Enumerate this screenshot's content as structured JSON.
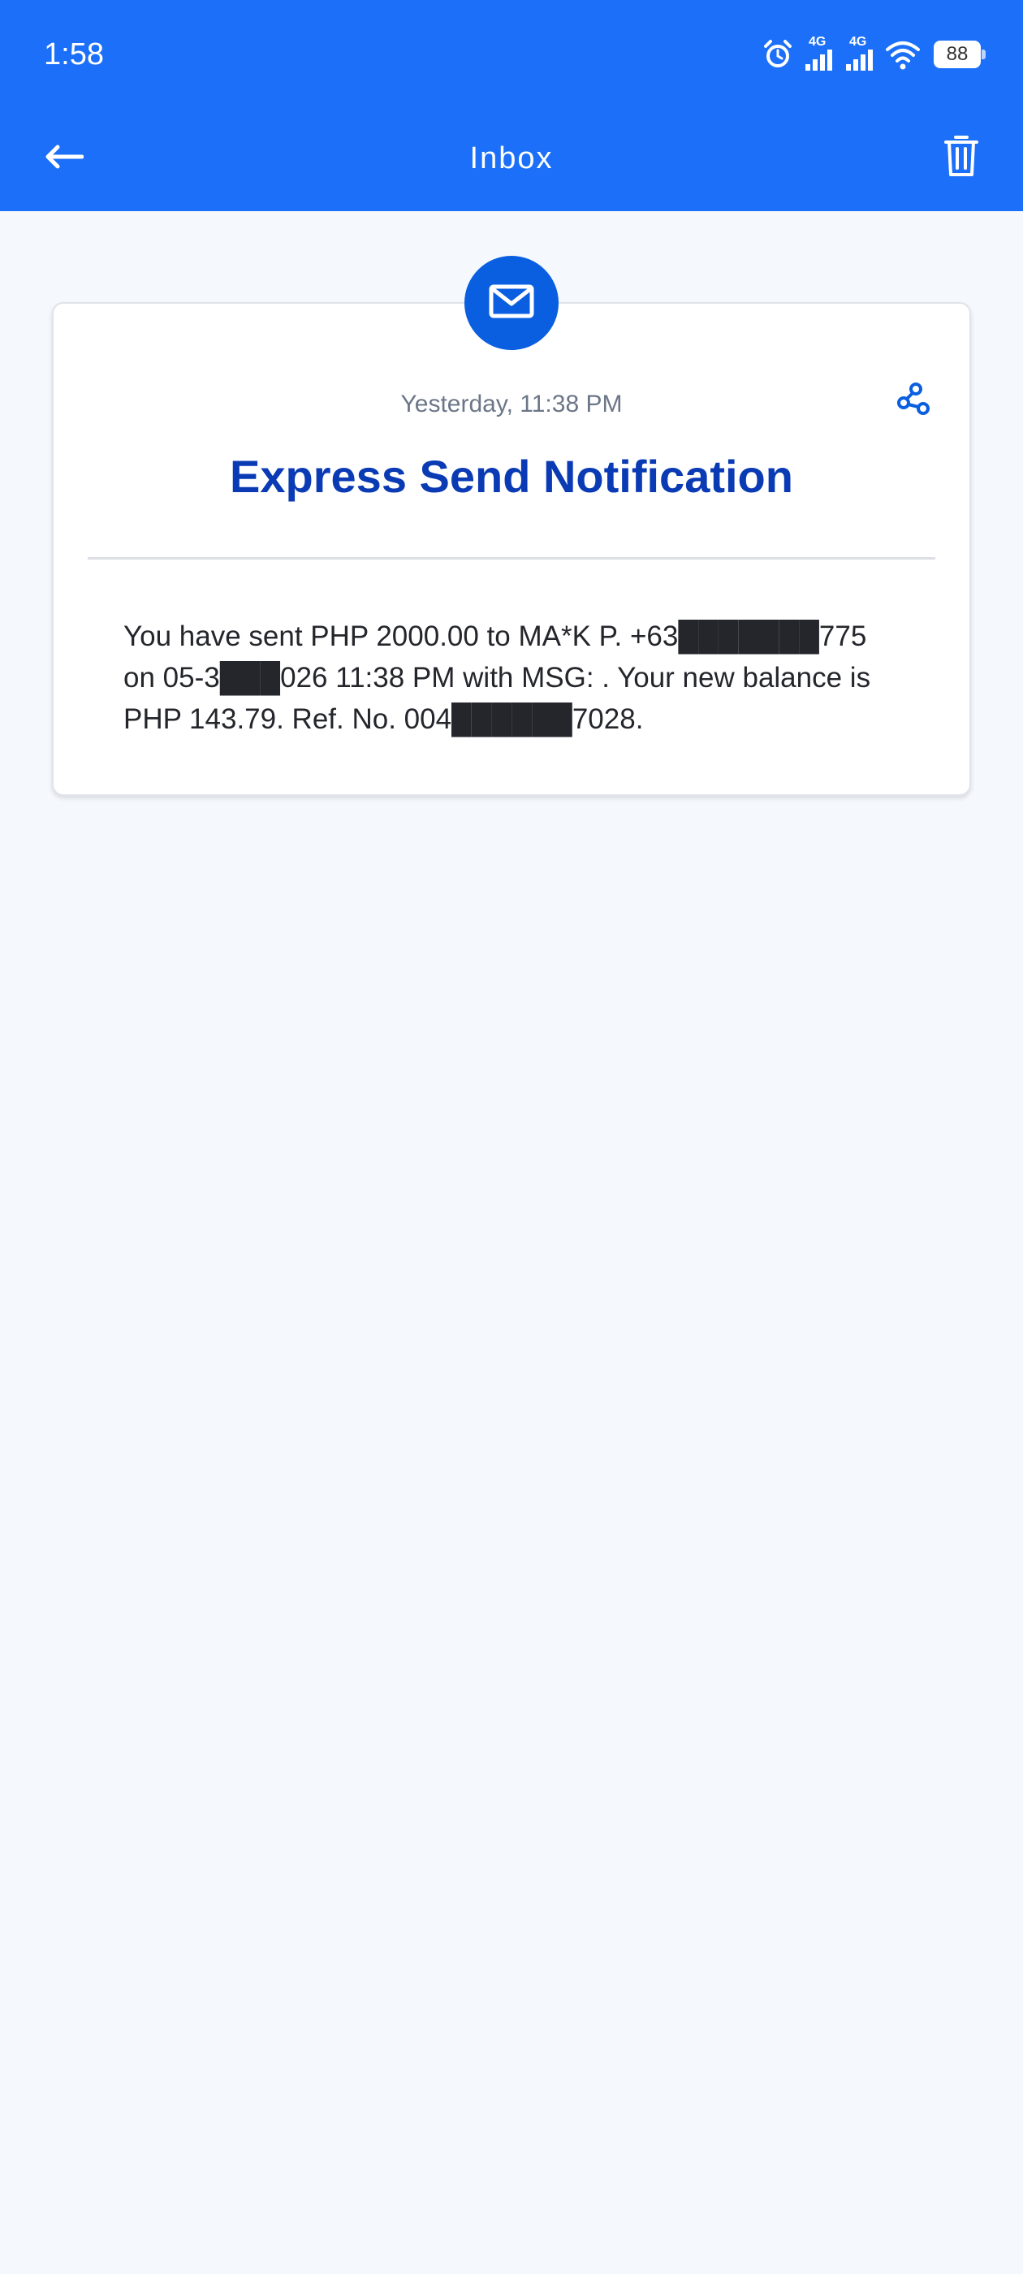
{
  "status_bar": {
    "time": "1:58",
    "network_1": "4G",
    "network_2": "4G",
    "battery": "88"
  },
  "header": {
    "title": "Inbox"
  },
  "message": {
    "date": "Yesterday, 11:38 PM",
    "title": "Express Send Notification",
    "body": "You have sent PHP 2000.00 to MA*K P. +63███████775 on 05-3███026 11:38 PM with MSG: . Your new balance is PHP 143.79. Ref. No. 004██████7028."
  },
  "colors": {
    "header_blue": "#1B6FF8",
    "title_blue": "#0A3BB4",
    "badge_blue": "#0A5FE0",
    "background": "#F5F8FD"
  },
  "icons": {
    "back": "arrow-left-icon",
    "delete": "trash-icon",
    "share": "share-icon",
    "mail": "envelope-icon",
    "alarm": "alarm-icon",
    "wifi": "wifi-icon"
  }
}
